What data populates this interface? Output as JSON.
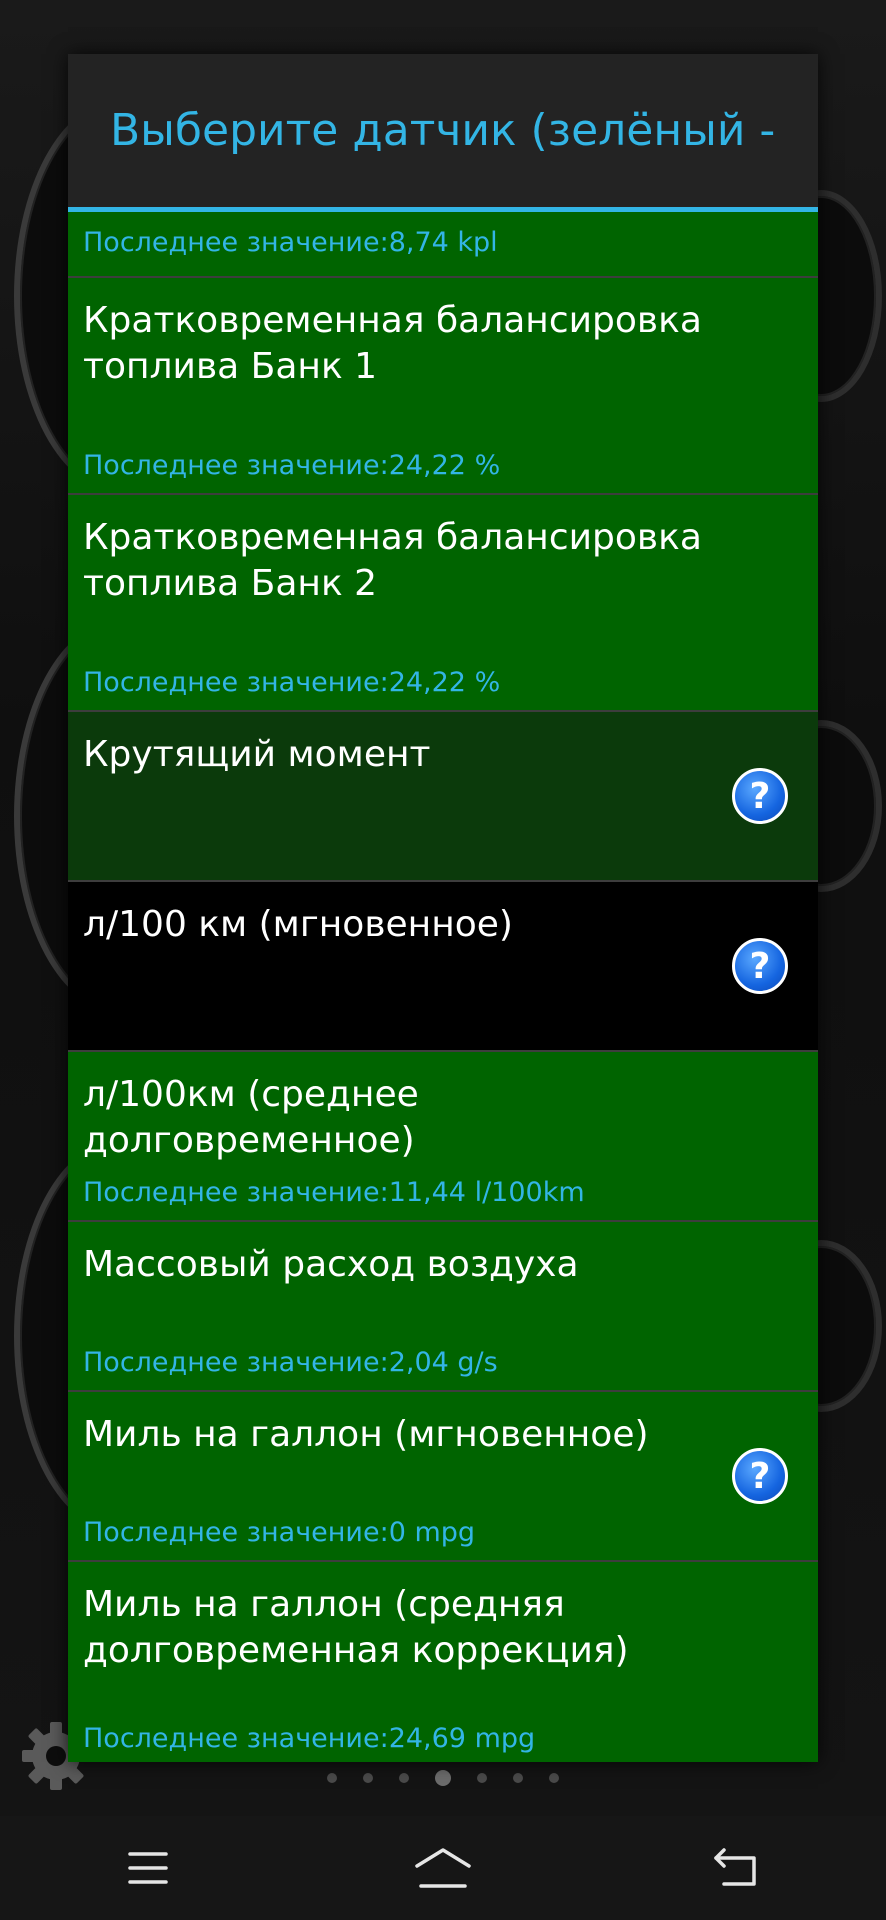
{
  "dialog": {
    "title": "Выберите датчик (зелёный -"
  },
  "sensors": [
    {
      "title": "",
      "last": "Последнее значение:8,74 kpl"
    },
    {
      "title": "Кратковременная балансировка топлива Банк 1",
      "last": "Последнее значение:24,22 %"
    },
    {
      "title": "Кратковременная балансировка топлива Банк 2",
      "last": "Последнее значение:24,22 %"
    },
    {
      "title": "Крутящий момент",
      "last": ""
    },
    {
      "title": "л/100 км (мгновенное)",
      "last": ""
    },
    {
      "title": "л/100км (среднее долговременное)",
      "last": "Последнее значение:11,44 l/100km"
    },
    {
      "title": "Массовый расход воздуха",
      "last": "Последнее значение:2,04 g/s"
    },
    {
      "title": "Миль на галлон (мгновенное)",
      "last": "Последнее значение:0 mpg"
    },
    {
      "title": "Миль на галлон (средняя долговременная коррекция)",
      "last": "Последнее значение:24,69 mpg"
    }
  ],
  "help_icon": "?",
  "pager": {
    "pages": 7,
    "active": 4
  },
  "colors": {
    "accent": "#33b5e5",
    "item_green": "#006400",
    "item_dark_green": "#0b3a0b",
    "item_black": "#000000"
  },
  "icons": {
    "settings": "gear-icon",
    "nav_menu": "menu-icon",
    "nav_home": "home-icon",
    "nav_back": "back-icon",
    "help": "help-icon"
  }
}
